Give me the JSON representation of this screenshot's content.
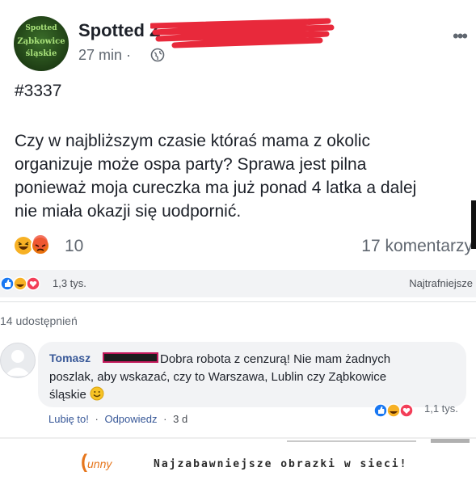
{
  "post": {
    "avatar_line1": "Spotted",
    "avatar_line2": "Ząbkowice",
    "avatar_line3": "śląskie",
    "page_name": "Spotted Z",
    "time": "27 min ·",
    "hashtag": "#3337",
    "text_lines": [
      "Czy w najbliższym czasie któraś mama z okolic",
      "organizuje może ospa party? Sprawa jest pilna",
      "ponieważ moja cureczka ma już  ponad 4 latka a dalej",
      "nie miała okazji się uodpornić."
    ],
    "reaction_count": "10",
    "comments_label": "17 komentarzy",
    "more_label": "•••"
  },
  "reply_bar": {
    "reactions_count": "1,3 tys.",
    "sort_label": "Najtrafniejsze"
  },
  "shares_label": "14 udostępnień",
  "comment": {
    "author": "Tomasz",
    "line1": "Dobra robota z cenzurą! Nie mam żadnych",
    "line2": "poszlak, aby wskazać, czy to Warszawa, Lublin czy Ząbkowice",
    "line3": "śląskie",
    "reactions_count": "1,1 tys.",
    "like_label": "Lubię to!",
    "separator": "·",
    "reply_label": "Odpowiedz",
    "age_label": "3 d"
  },
  "footer": {
    "logo_prefix": "(",
    "logo_text": "unny",
    "tagline": "Najzabawniejsze obrazki w sieci!"
  },
  "colors": {
    "scribble_red": "#e8293b",
    "link_blue": "#385898",
    "like_blue": "#1877f2",
    "love_red": "#f33e58",
    "haha_yellow": "#f7b125",
    "footer_orange": "#e6761c"
  },
  "icons": [
    "globe-icon",
    "more-icon",
    "haha-reaction-icon",
    "angry-reaction-icon",
    "like-reaction-icon",
    "love-reaction-icon",
    "smile-emoji-icon",
    "default-avatar-icon"
  ]
}
